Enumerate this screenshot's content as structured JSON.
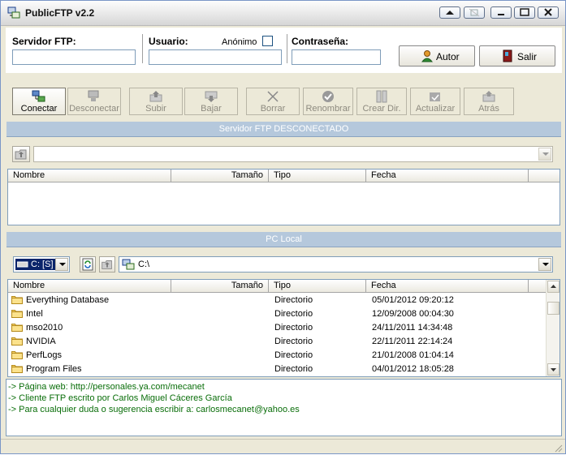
{
  "window": {
    "title": "PublicFTP  v2.2"
  },
  "login": {
    "server_label": "Servidor FTP:",
    "user_label": "Usuario:",
    "anon_label": "Anónimo",
    "anon_checked": false,
    "password_label": "Contraseña:",
    "server_value": "",
    "user_value": "",
    "password_value": "",
    "author_button": "Autor",
    "exit_button": "Salir"
  },
  "toolbar": {
    "items": [
      {
        "label": "Conectar",
        "enabled": true,
        "icon": "connect-icon"
      },
      {
        "label": "Desconectar",
        "enabled": false,
        "icon": "disconnect-icon"
      },
      {
        "label": "Subir",
        "enabled": false,
        "icon": "upload-icon"
      },
      {
        "label": "Bajar",
        "enabled": false,
        "icon": "download-icon"
      },
      {
        "label": "Borrar",
        "enabled": false,
        "icon": "delete-icon"
      },
      {
        "label": "Renombrar",
        "enabled": false,
        "icon": "rename-icon"
      },
      {
        "label": "Crear Dir.",
        "enabled": false,
        "icon": "create-dir-icon"
      },
      {
        "label": "Actualizar",
        "enabled": false,
        "icon": "refresh-icon"
      },
      {
        "label": "Atrás",
        "enabled": false,
        "icon": "back-icon"
      }
    ]
  },
  "server": {
    "status": "Servidor FTP DESCONECTADO",
    "path": "",
    "columns": [
      "Nombre",
      "Tamaño",
      "Tipo",
      "Fecha"
    ]
  },
  "local": {
    "title": "PC Local",
    "drive": "C: [S]",
    "path": "C:\\",
    "columns": [
      "Nombre",
      "Tamaño",
      "Tipo",
      "Fecha"
    ],
    "rows": [
      {
        "name": "Everything Database",
        "size": "",
        "type": "Directorio",
        "date": "05/01/2012 09:20:12"
      },
      {
        "name": "Intel",
        "size": "",
        "type": "Directorio",
        "date": "12/09/2008 00:04:30"
      },
      {
        "name": "mso2010",
        "size": "",
        "type": "Directorio",
        "date": "24/11/2011 14:34:48"
      },
      {
        "name": "NVIDIA",
        "size": "",
        "type": "Directorio",
        "date": "22/11/2011 22:14:24"
      },
      {
        "name": "PerfLogs",
        "size": "",
        "type": "Directorio",
        "date": "21/01/2008 01:04:14"
      },
      {
        "name": "Program Files",
        "size": "",
        "type": "Directorio",
        "date": "04/01/2012 18:05:28"
      }
    ]
  },
  "messages": [
    "-> Página web: http://personales.ya.com/mecanet",
    "-> Cliente FTP escrito por Carlos Miguel Cáceres García",
    "-> Para cualquier duda o sugerencia escribir a: carlosmecanet@yahoo.es"
  ],
  "colors": {
    "message": "#0a6e0a",
    "statusbar": "#b5c8dc",
    "drive_select": "#0a246a"
  }
}
